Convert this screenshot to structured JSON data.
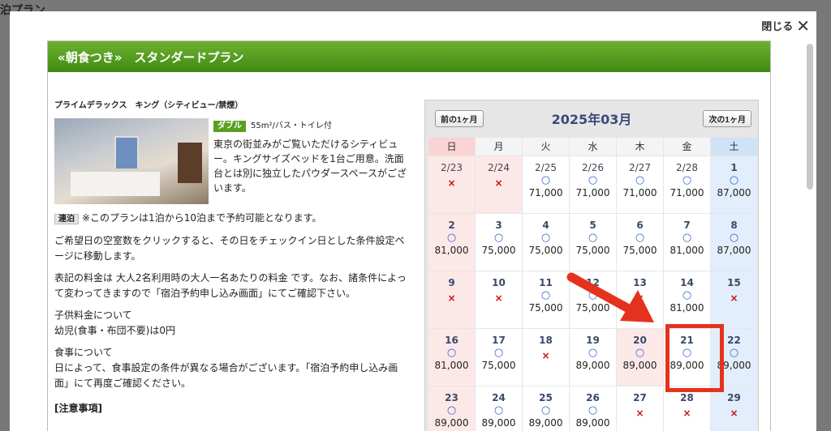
{
  "background_title": "泊プラン",
  "modal": {
    "close_label": "閉じる"
  },
  "plan_title": "«朝食つき»　スタンダードプラン",
  "room": {
    "name": "プライムデラックス　キング（シティビュー/禁煙）",
    "badge": "ダブル",
    "spec": "55m²/バス・トイレ付",
    "description": "東京の街並みがご覧いただけるシティビュー。キングサイズベッドを1台ご用意。洗面台とは別に独立したパウダースペースがございます。"
  },
  "stay": {
    "badge": "連泊",
    "text": "※このプランは1泊から10泊まで予約可能となります。"
  },
  "para1": "ご希望日の空室数をクリックすると、その日をチェックイン日とした条件設定ページに移動します。",
  "para2": "表記の料金は 大人2名利用時の大人一名あたりの料金 です。なお、諸条件によって変わってきますので「宿泊予約申し込み画面」にてご確認下さい。",
  "child_heading": "子供料金について",
  "child_text": "幼児(食事・布団不要)は0円",
  "meal_heading": "食事について",
  "meal_text": "日によって、食事設定の条件が異なる場合がございます。「宿泊予約申し込み画面」にて再度ご確認ください。",
  "notice_heading": "[注意事項]",
  "calendar": {
    "prev_label": "前の1ヶ月",
    "next_label": "次の1ヶ月",
    "month_label": "2025年03月",
    "weekdays": [
      "日",
      "月",
      "火",
      "水",
      "木",
      "金",
      "土"
    ],
    "days": [
      {
        "day": "2/23",
        "mark": "×",
        "price": ""
      },
      {
        "day": "2/24",
        "mark": "×",
        "price": ""
      },
      {
        "day": "2/25",
        "mark": "○",
        "price": "71,000"
      },
      {
        "day": "2/26",
        "mark": "○",
        "price": "71,000"
      },
      {
        "day": "2/27",
        "mark": "○",
        "price": "71,000"
      },
      {
        "day": "2/28",
        "mark": "○",
        "price": "71,000"
      },
      {
        "day": "1",
        "mark": "○",
        "price": "87,000"
      },
      {
        "day": "2",
        "mark": "○",
        "price": "81,000"
      },
      {
        "day": "3",
        "mark": "○",
        "price": "75,000"
      },
      {
        "day": "4",
        "mark": "○",
        "price": "75,000"
      },
      {
        "day": "5",
        "mark": "○",
        "price": "75,000"
      },
      {
        "day": "6",
        "mark": "○",
        "price": "75,000"
      },
      {
        "day": "7",
        "mark": "○",
        "price": "81,000"
      },
      {
        "day": "8",
        "mark": "○",
        "price": "87,000"
      },
      {
        "day": "9",
        "mark": "×",
        "price": ""
      },
      {
        "day": "10",
        "mark": "×",
        "price": ""
      },
      {
        "day": "11",
        "mark": "○",
        "price": "75,000"
      },
      {
        "day": "12",
        "mark": "○",
        "price": "75,000"
      },
      {
        "day": "13",
        "mark": "×",
        "price": ""
      },
      {
        "day": "14",
        "mark": "○",
        "price": "81,000"
      },
      {
        "day": "15",
        "mark": "×",
        "price": ""
      },
      {
        "day": "16",
        "mark": "○",
        "price": "81,000"
      },
      {
        "day": "17",
        "mark": "○",
        "price": "75,000"
      },
      {
        "day": "18",
        "mark": "×",
        "price": ""
      },
      {
        "day": "19",
        "mark": "○",
        "price": "89,000"
      },
      {
        "day": "20",
        "mark": "○",
        "price": "89,000"
      },
      {
        "day": "21",
        "mark": "○",
        "price": "89,000"
      },
      {
        "day": "22",
        "mark": "○",
        "price": "89,000"
      },
      {
        "day": "23",
        "mark": "○",
        "price": "89,000"
      },
      {
        "day": "24",
        "mark": "○",
        "price": "89,000"
      },
      {
        "day": "25",
        "mark": "○",
        "price": "89,000"
      },
      {
        "day": "26",
        "mark": "○",
        "price": "89,000"
      },
      {
        "day": "27",
        "mark": "×",
        "price": ""
      },
      {
        "day": "28",
        "mark": "×",
        "price": ""
      },
      {
        "day": "29",
        "mark": "×",
        "price": ""
      }
    ]
  },
  "colors": {
    "header_green": "#4f9a1c",
    "highlight_red": "#e5321e",
    "available_blue": "#3366cc",
    "full_red": "#cc1111"
  }
}
